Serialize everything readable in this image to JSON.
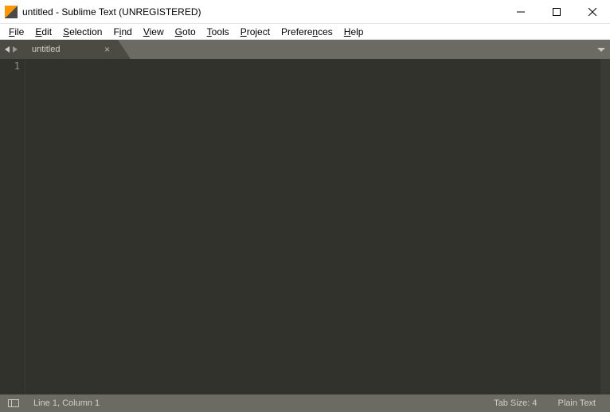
{
  "window": {
    "title": "untitled - Sublime Text (UNREGISTERED)"
  },
  "menu": {
    "file": {
      "label": "File",
      "mnemonic": "F"
    },
    "edit": {
      "label": "Edit",
      "mnemonic": "E"
    },
    "selection": {
      "label": "Selection",
      "mnemonic": "S"
    },
    "find": {
      "label": "Find",
      "mnemonic": "i"
    },
    "view": {
      "label": "View",
      "mnemonic": "V"
    },
    "goto": {
      "label": "Goto",
      "mnemonic": "G"
    },
    "tools": {
      "label": "Tools",
      "mnemonic": "T"
    },
    "project": {
      "label": "Project",
      "mnemonic": "P"
    },
    "preferences": {
      "label": "Preferences",
      "mnemonic": "n"
    },
    "help": {
      "label": "Help",
      "mnemonic": "H"
    }
  },
  "tabs": [
    {
      "label": "untitled",
      "active": true,
      "dirty": false
    }
  ],
  "editor": {
    "gutter_lines": [
      "1"
    ],
    "content": ""
  },
  "status": {
    "position": "Line 1, Column 1",
    "tab_size": "Tab Size: 4",
    "syntax": "Plain Text"
  },
  "colors": {
    "editor_bg": "#32322c",
    "chrome_bg": "#6b6b63",
    "tab_active_bg": "#4b4b44",
    "text_light": "#d0d0c8"
  }
}
